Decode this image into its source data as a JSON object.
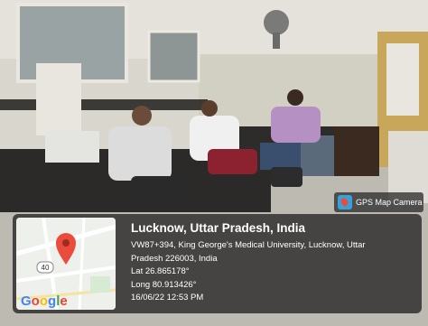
{
  "badge": {
    "label": "GPS Map Camera",
    "icon": "gps-map-camera-icon"
  },
  "map": {
    "road_marker": "40",
    "logo": "Google",
    "pin_color": "#e94b3c"
  },
  "location": {
    "title": "Lucknow, Uttar Pradesh, India",
    "address_line1": "VW87+394, King George's Medical University, Lucknow, Uttar",
    "address_line2": "Pradesh 226003, India",
    "lat": "Lat 26.865178°",
    "long": "Long 80.913426°",
    "timestamp": "16/06/22 12:53 PM"
  }
}
